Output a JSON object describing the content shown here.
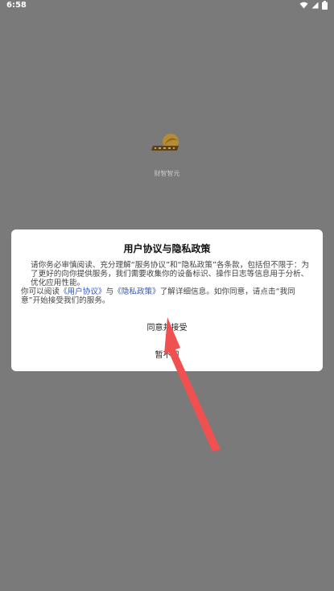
{
  "status_bar": {
    "time": "6:58",
    "icons": [
      "wifi-icon",
      "signal-icon",
      "battery-icon"
    ]
  },
  "splash": {
    "app_name": "财智智元",
    "logo_icon": "brand-logo-icon"
  },
  "dialog": {
    "title": "用户协议与隐私政策",
    "paragraph_1": "请你务必审慎阅读、充分理解“服务协议”和“隐私政策”各条款，包括但不限于：为了更好的向你提供服务，我们需要收集你的设备标识、操作日志等信息用于分析、优化应用性能。",
    "paragraph_2_prefix": "你可以阅读",
    "user_agreement_link": "《用户协议》",
    "paragraph_2_and": "与",
    "privacy_policy_link": "《隐私政策》",
    "paragraph_2_suffix": "了解详细信息。如你同意，请点击“我同意”开始接受我们的服务。",
    "agree_button": "同意并接受",
    "disagree_button": "暂不同"
  },
  "colors": {
    "background": "#7a7a7a",
    "dialog_background": "#ffffff",
    "link": "#3657b7",
    "arrow": "#f0504f"
  }
}
